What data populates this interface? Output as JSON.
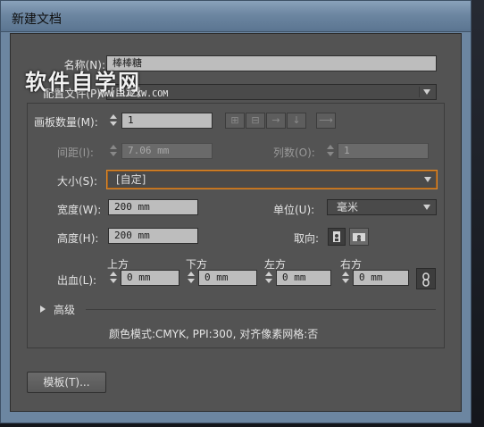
{
  "window": {
    "title": "新建文档"
  },
  "watermark": {
    "text": "软件自学网",
    "sub": "WWW.RJZXW.COM"
  },
  "name": {
    "label": "名称(N):",
    "value": "棒棒糖"
  },
  "profile": {
    "label": "配置文件(P):",
    "value": "[自定]"
  },
  "artboards": {
    "count_label": "画板数量(M):",
    "count_value": "1",
    "arrange_icons": [
      "grid-by-row-icon",
      "grid-by-column-icon",
      "arrange-by-row-icon",
      "arrange-by-column-icon",
      "right-to-left-layout-icon"
    ],
    "spacing_label": "间距(I):",
    "spacing_value": "7.06 mm",
    "columns_label": "列数(O):",
    "columns_value": "1"
  },
  "size": {
    "label": "大小(S):",
    "value": "[自定]"
  },
  "width": {
    "label": "宽度(W):",
    "value": "200 mm"
  },
  "units": {
    "label": "单位(U):",
    "value": "毫米"
  },
  "height": {
    "label": "高度(H):",
    "value": "200 mm"
  },
  "orientation": {
    "label": "取向:",
    "icons": [
      "portrait-icon",
      "landscape-icon"
    ]
  },
  "bleed": {
    "label": "出血(L):",
    "top_label": "上方",
    "top_value": "0 mm",
    "bottom_label": "下方",
    "bottom_value": "0 mm",
    "left_label": "左方",
    "left_value": "0 mm",
    "right_label": "右方",
    "right_value": "0 mm",
    "link_icon": "chain-link-icon"
  },
  "advanced": {
    "label": "高级"
  },
  "info": {
    "text": "颜色模式:CMYK, PPI:300, 对齐像素网格:否"
  },
  "buttons": {
    "templates": "模板(T)..."
  },
  "colors": {
    "panel": "#535353",
    "focus": "#e08a2a",
    "titlebar": "#6c86a1"
  }
}
